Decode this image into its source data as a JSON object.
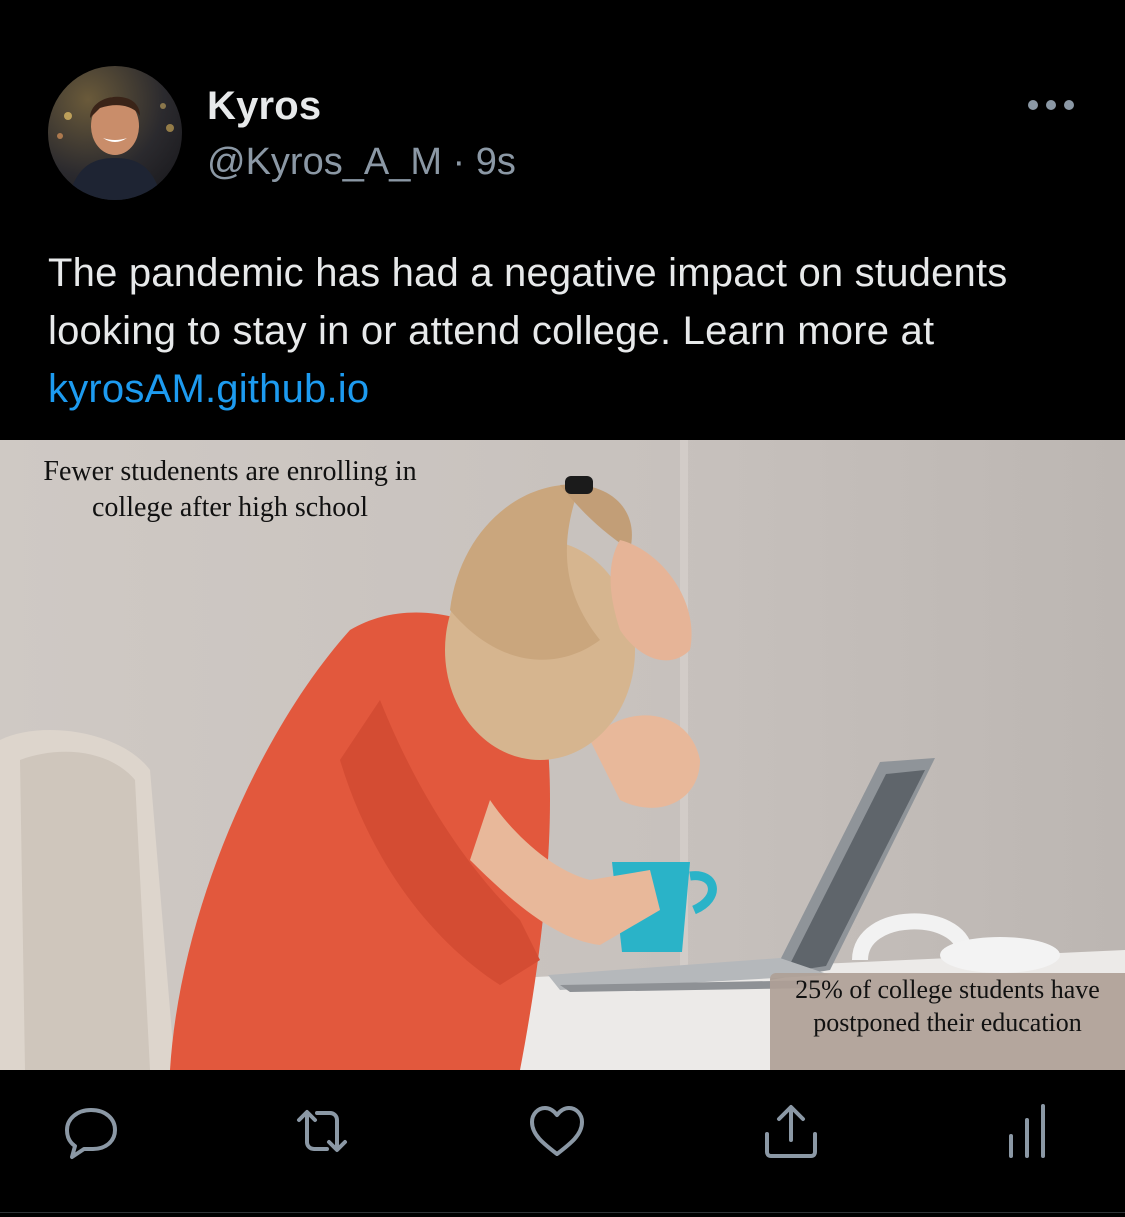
{
  "tweet": {
    "name": "Kyros",
    "handle": "@Kyros_A_M",
    "separator": " · ",
    "time": "9s",
    "text_before_link": "The pandemic has had a negative impact on students looking to stay in or attend college. Learn more at ",
    "link_text": "kyrosAM.github.io"
  },
  "media": {
    "caption_top": "Fewer studenents are enrolling in college after high school",
    "caption_bottom": "25% of college students have postponed their education"
  },
  "actions": [
    {
      "name": "reply",
      "icon": "reply-icon"
    },
    {
      "name": "retweet",
      "icon": "retweet-icon"
    },
    {
      "name": "like",
      "icon": "heart-icon"
    },
    {
      "name": "share",
      "icon": "share-icon"
    },
    {
      "name": "analytics",
      "icon": "analytics-icon"
    }
  ],
  "colors": {
    "background": "#000000",
    "text": "#e7e9ea",
    "secondary": "#8b98a5",
    "link": "#1d9bf0"
  }
}
